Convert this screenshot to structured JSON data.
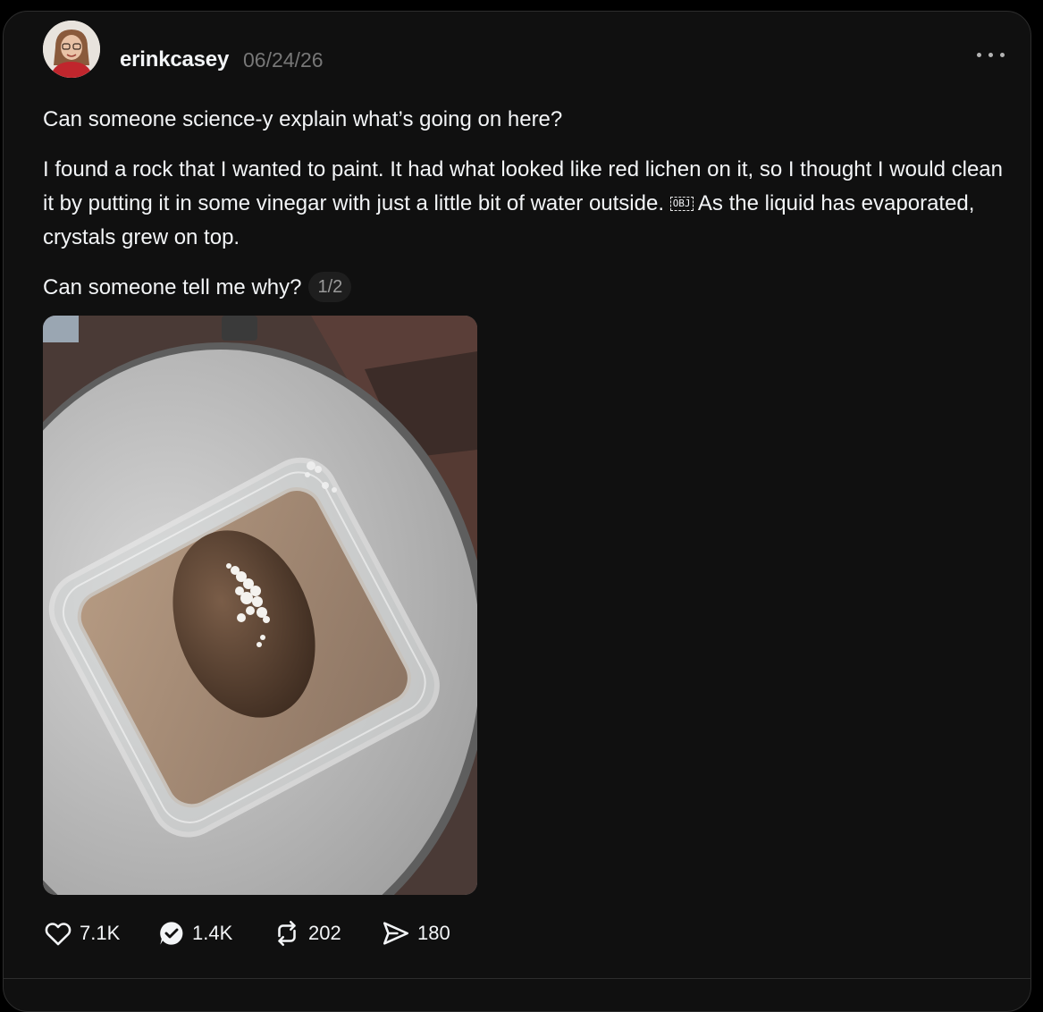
{
  "post": {
    "username": "erinkcasey",
    "date": "06/24/26",
    "paragraphs": [
      "Can someone science-y explain what’s going on here?",
      "I found a rock that I wanted to paint. It had what looked like red lichen on it, so I thought I would clean it by putting it in some vinegar with just a little bit of water outside.",
      "As the liquid has evaporated, crystals grew on top.",
      "Can someone tell me why?"
    ],
    "obj_glyph": "OBJ",
    "image_counter": "1/2"
  },
  "actions": {
    "likes": "7.1K",
    "replies": "1.4K",
    "reposts": "202",
    "shares": "180"
  },
  "colors": {
    "background": "#101010",
    "text": "#f3f5f7",
    "muted": "#777777",
    "border": "#2d2d2d"
  },
  "icons": [
    "more-icon",
    "heart-icon",
    "reply-icon",
    "repost-icon",
    "share-icon"
  ]
}
